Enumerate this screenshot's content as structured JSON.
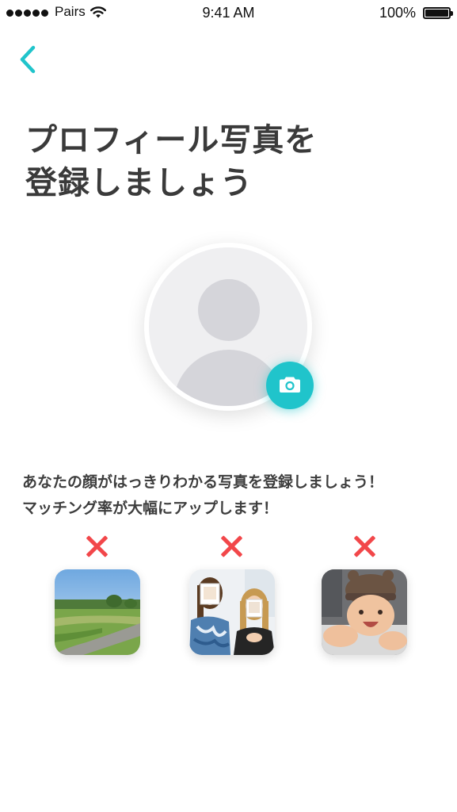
{
  "status_bar": {
    "carrier": "Pairs",
    "time": "9:41 AM",
    "battery": "100%",
    "battery_level": 1.0
  },
  "header": {
    "back_icon": "chevron-left-icon"
  },
  "title": {
    "line1": "プロフィール写真を",
    "line2": "登録しましょう"
  },
  "avatar": {
    "placeholder_icon": "person-silhouette-icon",
    "camera_icon": "camera-icon"
  },
  "description": {
    "line1": "あなたの顔がはっきりわかる写真を登録しましょう！",
    "line2": "マッチング率が大幅にアップします！"
  },
  "bad_examples": [
    {
      "icon": "x-icon",
      "image": "landscape-photo"
    },
    {
      "icon": "x-icon",
      "image": "group-photo-with-hidden-faces"
    },
    {
      "icon": "x-icon",
      "image": "baby-photo"
    }
  ],
  "colors": {
    "accent": "#20c4cb",
    "error": "#f2474a",
    "title_text": "#3a3a3a",
    "placeholder_bg": "#efeff1",
    "placeholder_shape": "#d5d5da"
  }
}
